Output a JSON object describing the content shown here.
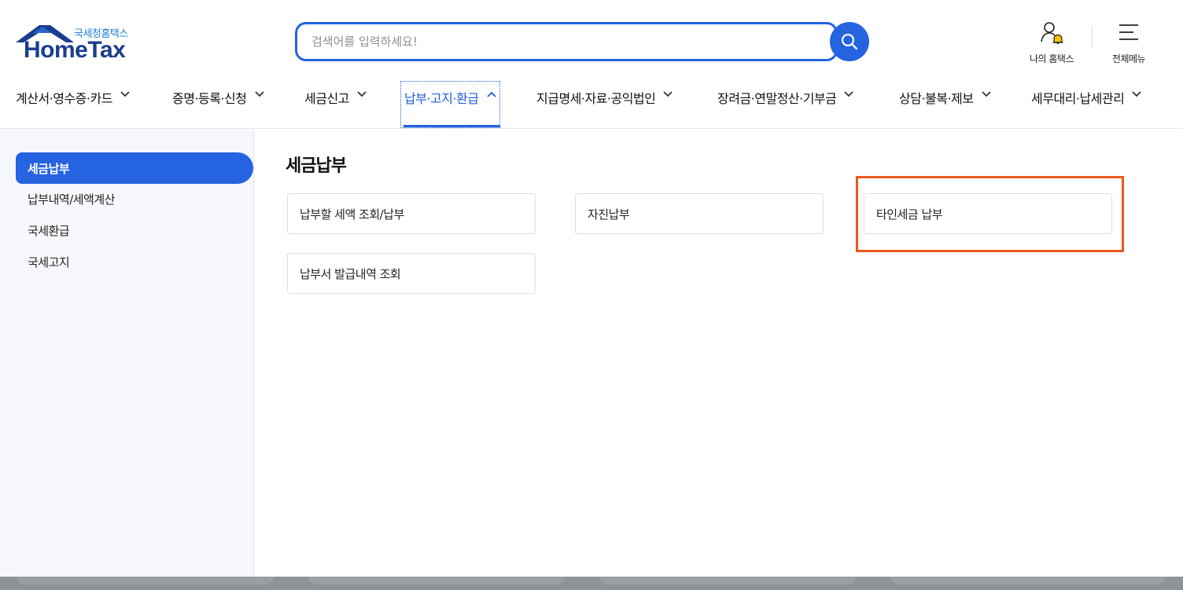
{
  "logo": {
    "subtitle": "국세청홈택스",
    "main": "HomeTax"
  },
  "search": {
    "placeholder": "검색어를 입력하세요!"
  },
  "utilities": {
    "my_hometax": "나의 홈택스",
    "all_menu": "전체메뉴"
  },
  "gnb": [
    {
      "label": "계산서·영수증·카드"
    },
    {
      "label": "증명·등록·신청"
    },
    {
      "label": "세금신고"
    },
    {
      "label": "납부·고지·환급"
    },
    {
      "label": "지급명세·자료·공익법인"
    },
    {
      "label": "장려금·연말정산·기부금"
    },
    {
      "label": "상담·불복·제보"
    },
    {
      "label": "세무대리·납세관리"
    }
  ],
  "sidebar": {
    "items": [
      {
        "label": "세금납부"
      },
      {
        "label": "납부내역/세액계산"
      },
      {
        "label": "국세환급"
      },
      {
        "label": "국세고지"
      }
    ]
  },
  "content": {
    "title": "세금납부",
    "cards": [
      {
        "label": "납부할 세액 조회/납부"
      },
      {
        "label": "자진납부"
      },
      {
        "label": "타인세금 납부"
      },
      {
        "label": "납부서 발급내역 조회"
      }
    ]
  },
  "colors": {
    "accent": "#2563e0",
    "brand_dark": "#1a3d8f",
    "highlight": "#e85a1a"
  },
  "icons": [
    "search-icon",
    "user-bell-icon",
    "hamburger-menu-icon",
    "chevron-down-icon",
    "chevron-up-icon"
  ]
}
